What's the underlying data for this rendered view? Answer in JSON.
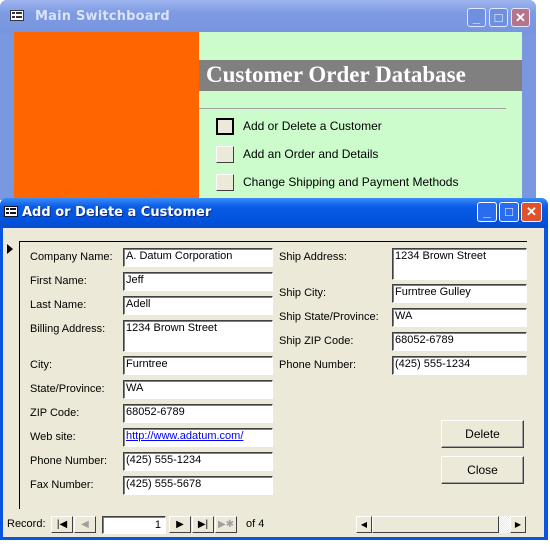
{
  "switchboard": {
    "title": "Main Switchboard",
    "banner": "Customer Order Database",
    "items": [
      {
        "label": "Add or Delete a Customer",
        "focused": true
      },
      {
        "label": "Add an Order and Details",
        "focused": false
      },
      {
        "label": "Change Shipping and Payment Methods",
        "focused": false
      }
    ],
    "colors": {
      "left_panel": "#ff6600",
      "background": "#ccfccc",
      "banner": "#808080"
    }
  },
  "customer_form": {
    "title": "Add or Delete a Customer",
    "left_fields": [
      {
        "label": "Company Name:",
        "value": "A. Datum Corporation"
      },
      {
        "label": "First Name:",
        "value": "Jeff"
      },
      {
        "label": "Last Name:",
        "value": "Adell"
      },
      {
        "label": "Billing Address:",
        "value": "1234 Brown Street"
      },
      {
        "label": "City:",
        "value": "Furntree"
      },
      {
        "label": "State/Province:",
        "value": "WA"
      },
      {
        "label": "ZIP Code:",
        "value": "68052-6789"
      },
      {
        "label": "Web site:",
        "value": "http://www.adatum.com/"
      },
      {
        "label": "Phone Number:",
        "value": "(425) 555-1234"
      },
      {
        "label": "Fax Number:",
        "value": "(425) 555-5678"
      }
    ],
    "right_fields": [
      {
        "label": "Ship Address:",
        "value": "1234 Brown Street"
      },
      {
        "label": "Ship City:",
        "value": "Furntree Gulley"
      },
      {
        "label": "Ship State/Province:",
        "value": "WA"
      },
      {
        "label": "Ship ZIP Code:",
        "value": "68052-6789"
      },
      {
        "label": "Phone Number:",
        "value": "(425) 555-1234"
      }
    ],
    "buttons": {
      "delete": "Delete",
      "close": "Close"
    },
    "navigation": {
      "label": "Record:",
      "current": "1",
      "of_label": "of",
      "total": "4",
      "first_glyph": "|◀",
      "prev_glyph": "◀",
      "next_glyph": "▶",
      "last_glyph": "▶|",
      "new_glyph": "▶✱"
    }
  },
  "window_controls": {
    "minimize": "_",
    "maximize": "□",
    "close": "✕"
  }
}
